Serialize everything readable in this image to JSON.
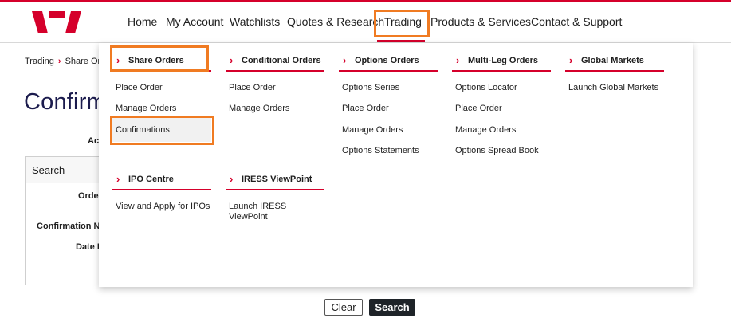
{
  "brand": {
    "accent": "#d5002b",
    "highlight": "#f07b22",
    "logo": "westpac-w-logo"
  },
  "nav": {
    "items": [
      "Home",
      "My Account",
      "Watchlists",
      "Quotes & Research",
      "Trading",
      "Products & Services",
      "Contact & Support"
    ],
    "active": "Trading"
  },
  "breadcrumb": {
    "items": [
      "Trading",
      "Share Or"
    ]
  },
  "page": {
    "title": "Confirm"
  },
  "background_form": {
    "labels": [
      "Ac",
      "Order",
      "Confirmation Nu",
      "Date R"
    ],
    "search_header": "Search",
    "clear_label": "Clear",
    "search_label": "Search"
  },
  "mega_menu": {
    "columns": [
      {
        "heading": "Share Orders",
        "links": [
          "Place Order",
          "Manage Orders",
          "Confirmations"
        ]
      },
      {
        "heading": "Conditional Orders",
        "links": [
          "Place Order",
          "Manage Orders"
        ]
      },
      {
        "heading": "Options Orders",
        "links": [
          "Options Series",
          "Place Order",
          "Manage Orders",
          "Options Statements"
        ]
      },
      {
        "heading": "Multi-Leg Orders",
        "links": [
          "Options Locator",
          "Place Order",
          "Manage Orders",
          "Options Spread Book"
        ]
      },
      {
        "heading": "Global Markets",
        "links": [
          "Launch Global Markets"
        ]
      },
      {
        "heading": "IPO Centre",
        "links": [
          "View and Apply for IPOs"
        ]
      },
      {
        "heading": "IRESS ViewPoint",
        "links": [
          "Launch IRESS",
          "ViewPoint"
        ]
      }
    ],
    "hovered_link": "Confirmations"
  },
  "icons": {
    "heading_chevron": "chevron-right-icon"
  }
}
